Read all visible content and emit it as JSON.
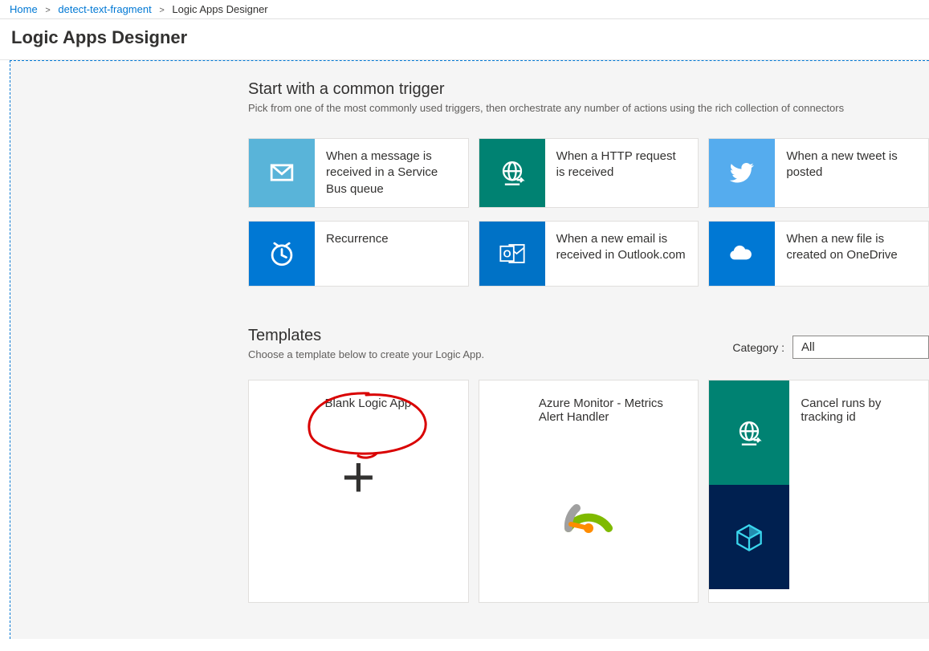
{
  "breadcrumb": {
    "home": "Home",
    "resource": "detect-text-fragment",
    "current": "Logic Apps Designer"
  },
  "page_title": "Logic Apps Designer",
  "triggers_section": {
    "title": "Start with a common trigger",
    "subtitle": "Pick from one of the most commonly used triggers, then orchestrate any number of actions using the rich collection of connectors"
  },
  "triggers": [
    {
      "id": "servicebus",
      "label": "When a message is received in a Service Bus queue",
      "color": "#59b4d9"
    },
    {
      "id": "http",
      "label": "When a HTTP request is received",
      "color": "#008272"
    },
    {
      "id": "twitter",
      "label": "When a new tweet is posted",
      "color": "#55acee"
    },
    {
      "id": "recurrence",
      "label": "Recurrence",
      "color": "#0078d4"
    },
    {
      "id": "outlook",
      "label": "When a new email is received in Outlook.com",
      "color": "#0072c6"
    },
    {
      "id": "onedrive",
      "label": "When a new file is created on OneDrive",
      "color": "#0078d4"
    }
  ],
  "templates_section": {
    "title": "Templates",
    "subtitle": "Choose a template below to create your Logic App.",
    "category_label": "Category :",
    "category_value": "All"
  },
  "templates": [
    {
      "id": "blank",
      "label": "Blank Logic App"
    },
    {
      "id": "azure-monitor",
      "label": "Azure Monitor - Metrics Alert Handler"
    },
    {
      "id": "cancel-runs",
      "label": "Cancel runs by tracking id"
    }
  ]
}
